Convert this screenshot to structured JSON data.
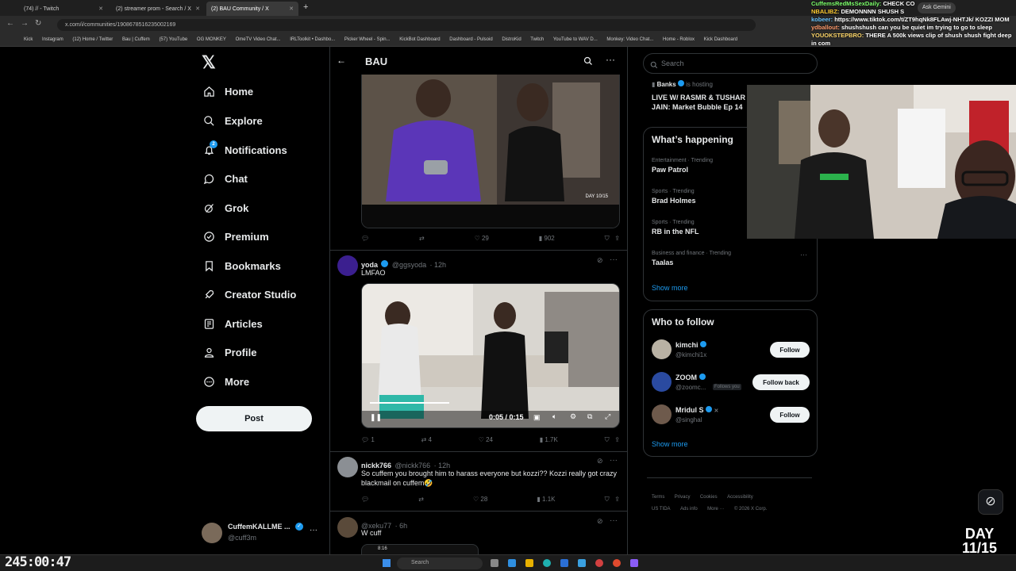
{
  "browser": {
    "tabs": [
      {
        "label": "(74) // - Twitch",
        "active": false
      },
      {
        "label": "(2) streamer prom - Search / X",
        "active": false
      },
      {
        "label": "(2) BAU Community / X",
        "active": true
      }
    ],
    "url": "x.com/i/communities/1908678516235002169",
    "gemini": "Ask Gemini",
    "bookmarks": [
      "Kick",
      "Instagram",
      "(12) Home / Twitter",
      "Bau | Cuffem",
      "(57) YouTube",
      "OG MONKEY",
      "OmeTV Video Chat...",
      "IRLToolkit • Dashbo...",
      "Picker Wheel - Spin...",
      "KickBot Dashboard",
      "Dashboard - Pulsoid",
      "DistroKid",
      "Twitch",
      "YouTube to WAV D...",
      "Monkey: Video Chat...",
      "Home - Roblox",
      "Kick Dashboard"
    ]
  },
  "sidebar": {
    "logo": "𝕏",
    "items": [
      {
        "label": "Home",
        "icon": "home-icon"
      },
      {
        "label": "Explore",
        "icon": "search-icon"
      },
      {
        "label": "Notifications",
        "icon": "bell-icon"
      },
      {
        "label": "Chat",
        "icon": "chat-icon"
      },
      {
        "label": "Grok",
        "icon": "grok-icon"
      },
      {
        "label": "Premium",
        "icon": "premium-icon"
      },
      {
        "label": "Bookmarks",
        "icon": "bookmark-icon"
      },
      {
        "label": "Creator Studio",
        "icon": "rocket-icon"
      },
      {
        "label": "Articles",
        "icon": "article-icon"
      },
      {
        "label": "Profile",
        "icon": "person-icon"
      },
      {
        "label": "More",
        "icon": "more-icon"
      }
    ],
    "notifications_badge": "2",
    "post_label": "Post",
    "account": {
      "name": "CuffemKALLME ...",
      "handle": "@cuff3m"
    }
  },
  "feed": {
    "title": "BAU",
    "tweet1": {
      "reply": "",
      "retweet": "",
      "like": "29",
      "views": "902",
      "media_caption": "DAY 10/15"
    },
    "tweet2": {
      "name": "yoda",
      "handle": "@ggsyoda",
      "time": "· 12h",
      "text": "LMFAO",
      "video_time": "0:05 / 0:15",
      "reply": "1",
      "retweet": "4",
      "like": "24",
      "views": "1.7K"
    },
    "tweet3": {
      "name": "nickk766",
      "handle": "@nickk766",
      "time": "· 12h",
      "text": "So cuffem you brought him to harass everyone but kozzi?? Kozzi really got crazy blackmail on cuffem🤣",
      "reply": "",
      "retweet": "",
      "like": "28",
      "views": "1.1K"
    },
    "tweet4": {
      "handle": "@xeku77",
      "time": "· 6h",
      "text": "W cuff",
      "media_time": "8:16"
    }
  },
  "right": {
    "search_placeholder": "Search",
    "live": {
      "host": "Banks",
      "hosting": "is hosting",
      "title": "LIVE W/ RASMR & TUSHAR JAIN: Market Bubble Ep 14"
    },
    "happening_title": "What’s happening",
    "trends": [
      {
        "meta": "Entertainment · Trending",
        "name": "Paw Patrol"
      },
      {
        "meta": "Sports · Trending",
        "name": "Brad Holmes"
      },
      {
        "meta": "Sports · Trending",
        "name": "RB in the NFL"
      },
      {
        "meta": "Business and finance · Trending",
        "name": "Taalas"
      }
    ],
    "show_more": "Show more",
    "who_to_follow_title": "Who to follow",
    "follow": [
      {
        "name": "kimchi",
        "handle": "@kimchi1x",
        "button": "Follow",
        "follows_you": ""
      },
      {
        "name": "ZOOM",
        "handle": "@zoomc...",
        "button": "Follow back",
        "follows_you": "Follows you"
      },
      {
        "name": "Mridul S",
        "handle": "@singhal",
        "button": "Follow",
        "follows_you": ""
      }
    ],
    "show_more2": "Show more",
    "footer": [
      "Terms",
      "Privacy",
      "Cookies",
      "Accessibility",
      "US TIDA",
      "Ads info",
      "More ···",
      "© 2026 X Corp."
    ]
  },
  "chat": [
    {
      "user": "CuffemsRedMsSexDaily:",
      "msg": "CHECK CO"
    },
    {
      "user": "NBALIBZ:",
      "msg": "DEMONNNN SHUSH S"
    },
    {
      "user": "kobeer:",
      "msg": "https://www.tiktok.com/t/ZT9hqNk8FLAwj-NHTJk/ KOZZI MOM"
    },
    {
      "user": "ydballout:",
      "msg": "shushshush can you be quiet im trying to go to sleep"
    },
    {
      "user": "YOUOKSTEPBRO:",
      "msg": "THERE A 500k views clip of shush shush fight deep in com"
    }
  ],
  "overlay": {
    "timer": "245:00:47",
    "day_line1": "DAY",
    "day_line2": "11/15"
  },
  "taskbar": {
    "search": "Search"
  }
}
